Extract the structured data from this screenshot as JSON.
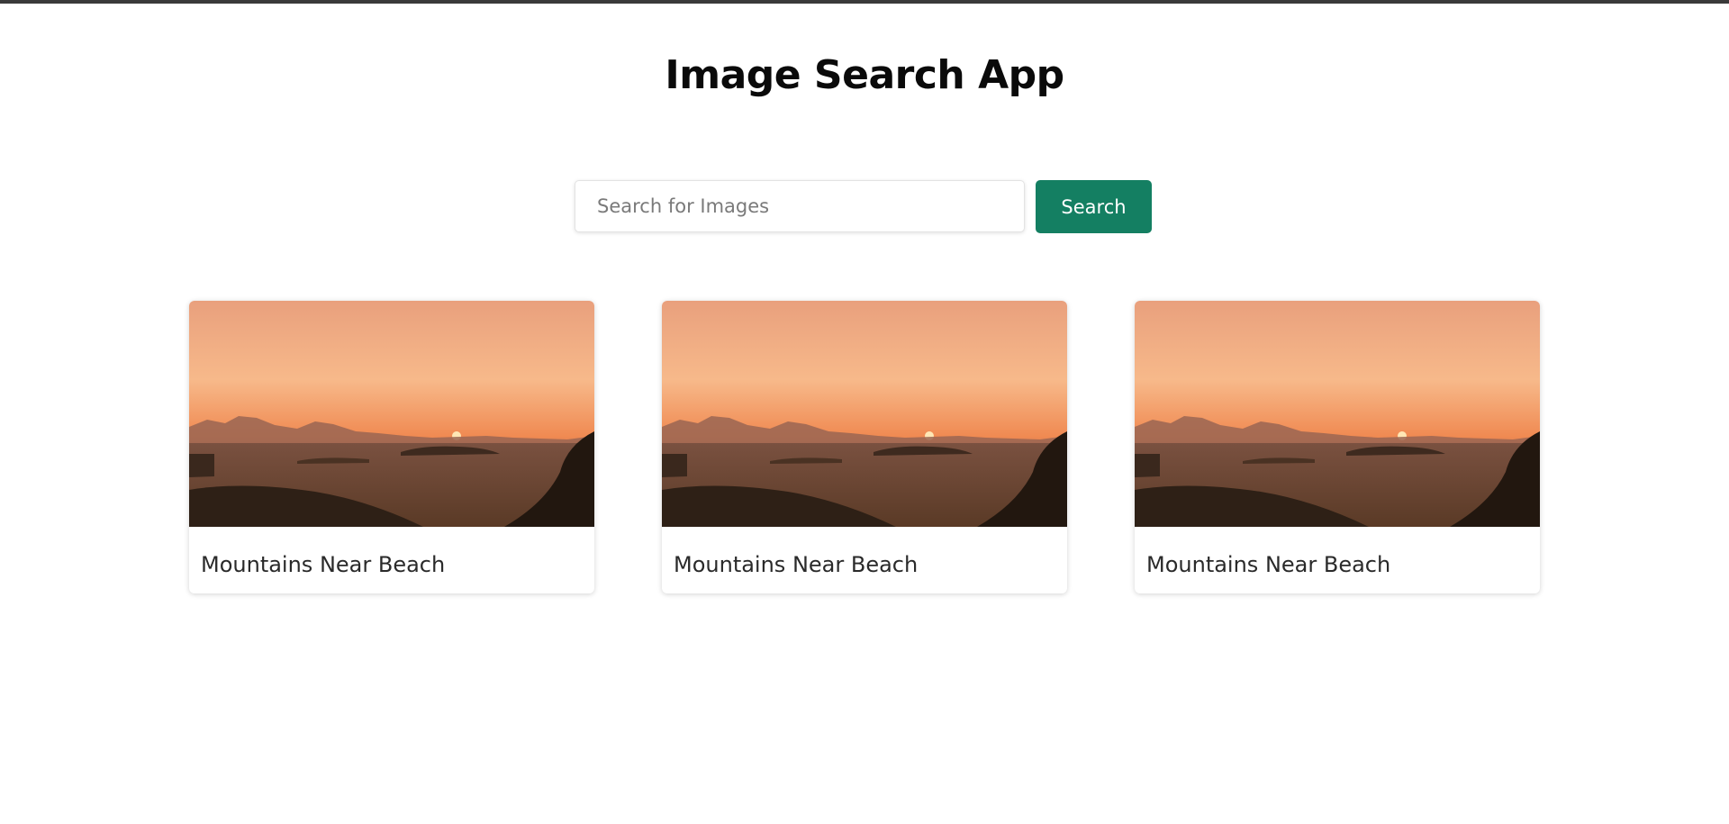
{
  "app": {
    "title": "Image Search App"
  },
  "search": {
    "placeholder": "Search for Images",
    "value": "",
    "button_label": "Search",
    "button_color": "#147f62"
  },
  "results": [
    {
      "title": "Mountains Near Beach",
      "image": "desert-sunset-photo"
    },
    {
      "title": "Mountains Near Beach",
      "image": "desert-sunset-photo"
    },
    {
      "title": "Mountains Near Beach",
      "image": "desert-sunset-photo"
    }
  ]
}
